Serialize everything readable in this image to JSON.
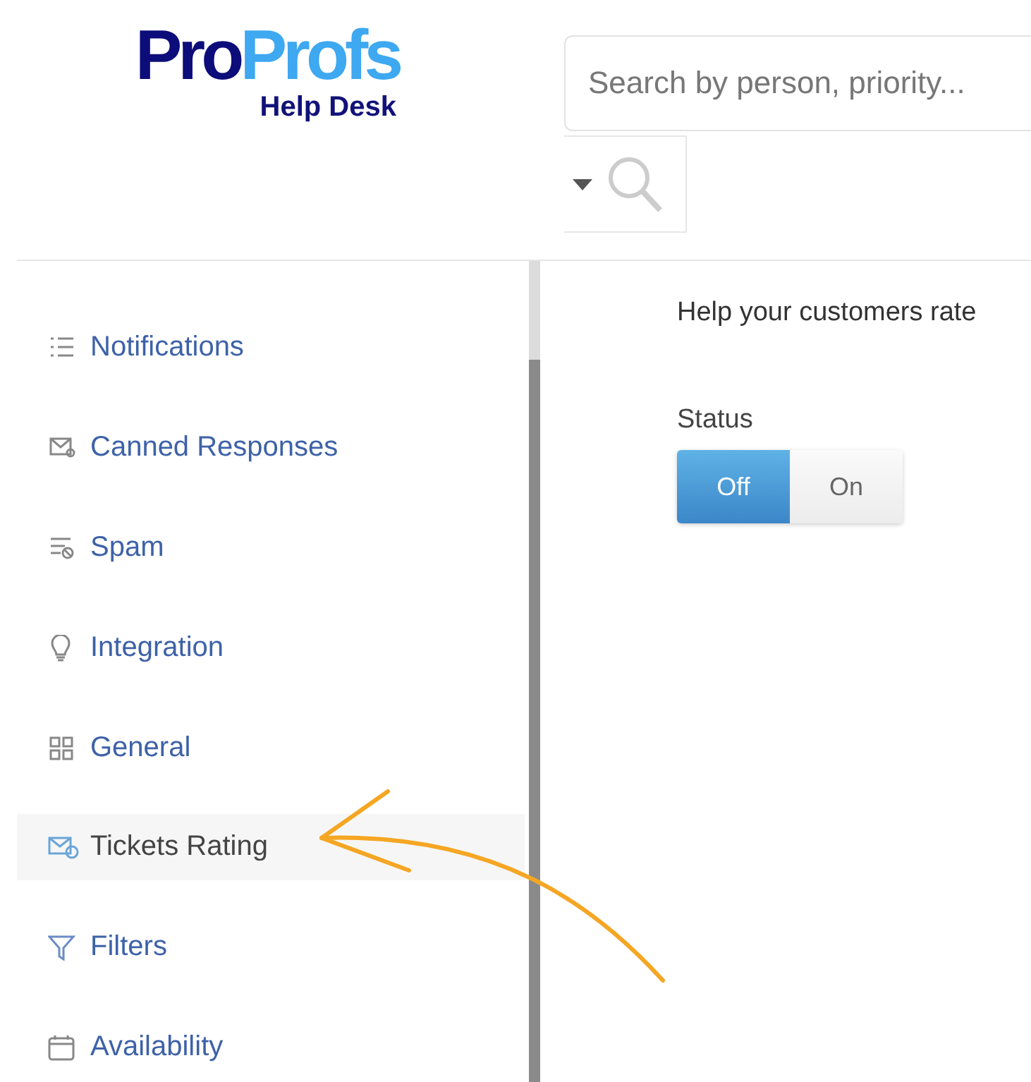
{
  "logo": {
    "part_1": "Pro",
    "part_2": "Profs",
    "subtitle": "Help Desk"
  },
  "search": {
    "placeholder": "Search by person, priority..."
  },
  "sidebar": {
    "items": [
      {
        "label": "Notifications",
        "kind": "list",
        "selected": false
      },
      {
        "label": "Canned Responses",
        "kind": "envelope",
        "selected": false
      },
      {
        "label": "Spam",
        "kind": "spam",
        "selected": false
      },
      {
        "label": "Integration",
        "kind": "bulb",
        "selected": false
      },
      {
        "label": "General",
        "kind": "grid",
        "selected": false
      },
      {
        "label": "Tickets Rating",
        "kind": "rating",
        "selected": true
      },
      {
        "label": "Filters",
        "kind": "funnel",
        "selected": false
      },
      {
        "label": "Availability",
        "kind": "calendar",
        "selected": false
      }
    ]
  },
  "content": {
    "description": "Help your customers rate",
    "status": {
      "label": "Status",
      "options": [
        {
          "label": "Off",
          "selected": true
        },
        {
          "label": "On",
          "selected": false
        }
      ]
    }
  }
}
